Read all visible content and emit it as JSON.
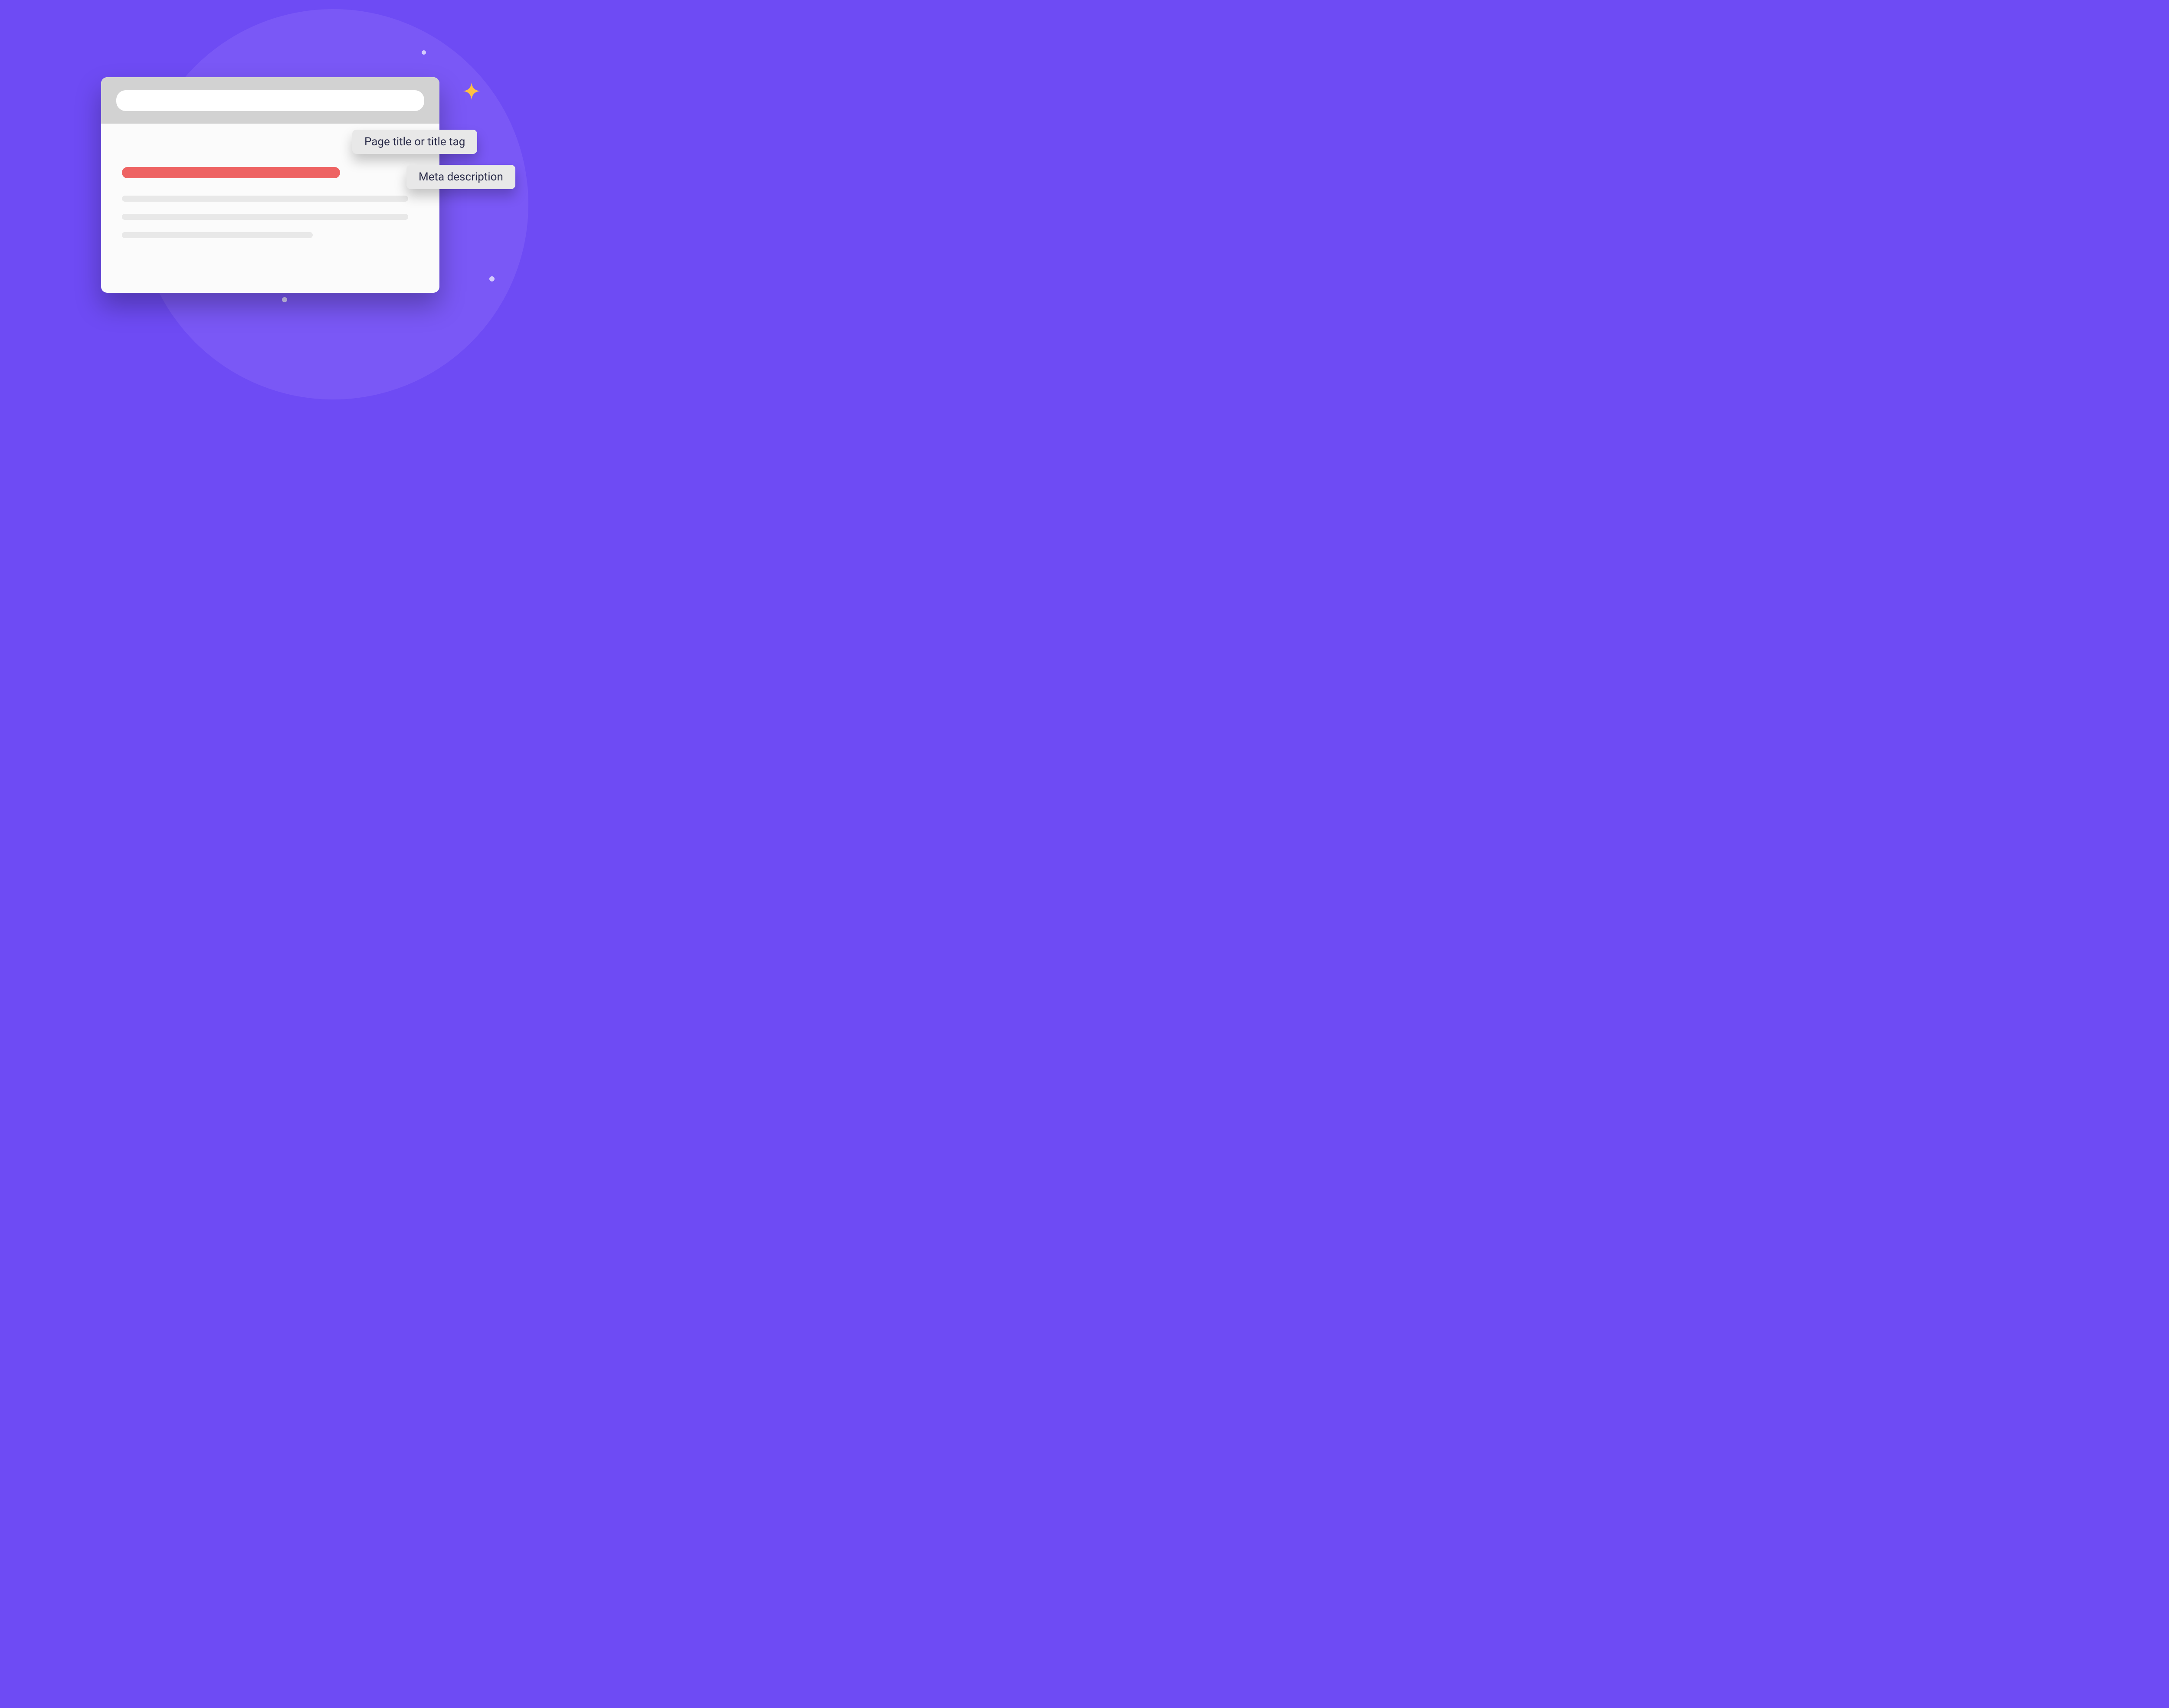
{
  "callouts": {
    "title_tag": "Page title or title tag",
    "meta_description": "Meta description"
  },
  "colors": {
    "background": "#6e4bf4",
    "circle": "#7a58f6",
    "title_bar": "#ee6363",
    "callout_bg": "#e8e8e8",
    "callout_text": "#2b2d4a",
    "sparkle": "#ffc043"
  }
}
